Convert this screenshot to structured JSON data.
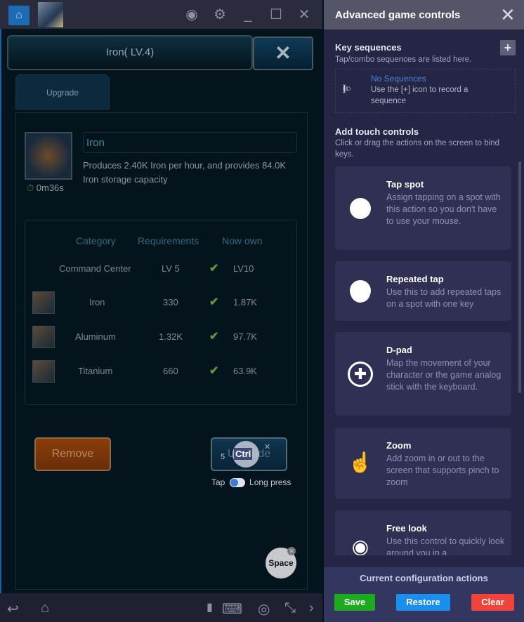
{
  "window": {
    "title_icons": [
      "home-icon",
      "game-icon",
      "profile-star-icon",
      "gear-icon",
      "minimize-icon",
      "maximize-icon",
      "close-icon"
    ]
  },
  "game": {
    "title": "Iron( LV.4)",
    "tab": "Upgrade",
    "building_name": "Iron",
    "description": "Produces 2.40K Iron per hour, and provides 84.0K Iron storage capacity",
    "timer": "0m36s",
    "table": {
      "headers": [
        "Category",
        "Requirements",
        "Now own"
      ],
      "rows": [
        {
          "category": "Command Center",
          "requirement": "LV 5",
          "own": "LV10"
        },
        {
          "category": "Iron",
          "requirement": "330",
          "own": "1.87K"
        },
        {
          "category": "Aluminum",
          "requirement": "1.32K",
          "own": "97.7K"
        },
        {
          "category": "Titanium",
          "requirement": "660",
          "own": "63.9K"
        }
      ]
    },
    "remove_label": "Remove",
    "upgrade_label": "Upgrade"
  },
  "overlay": {
    "ctrl_key": "Ctrl",
    "repeat_count": "5",
    "tap_label": "Tap",
    "long_press_label": "Long press",
    "space_key": "Space",
    "toggle_state": "tap"
  },
  "panel": {
    "title": "Advanced game controls",
    "key_sequences": {
      "title": "Key sequences",
      "subtitle": "Tap/combo sequences are listed here.",
      "empty_title": "No Sequences",
      "empty_hint": "Use the [+] icon to record a sequence"
    },
    "touch": {
      "title": "Add touch controls",
      "subtitle": "Click or drag the actions on the screen to bind keys.",
      "controls": [
        {
          "name": "Tap spot",
          "desc": "Assign tapping on a spot with this action so you don't have to use your mouse.",
          "icon": "circle-icon"
        },
        {
          "name": "Repeated tap",
          "desc": "Use this to add repeated taps on a spot with one key",
          "icon": "stacked-circle-icon"
        },
        {
          "name": "D-pad",
          "desc": "Map the movement of your character or the game analog stick with the keyboard.",
          "icon": "dpad-icon"
        },
        {
          "name": "Zoom",
          "desc": "Add zoom in or out to the screen that supports pinch to zoom",
          "icon": "pinch-icon"
        },
        {
          "name": "Free look",
          "desc": "Use this control to quickly look around you in a",
          "icon": "eye-icon"
        }
      ]
    },
    "footer": {
      "title": "Current configuration actions",
      "save": "Save",
      "restore": "Restore",
      "clear": "Clear"
    },
    "colors": {
      "save": "#1eaa1e",
      "restore": "#1a8ff0",
      "clear": "#f0443a"
    }
  }
}
